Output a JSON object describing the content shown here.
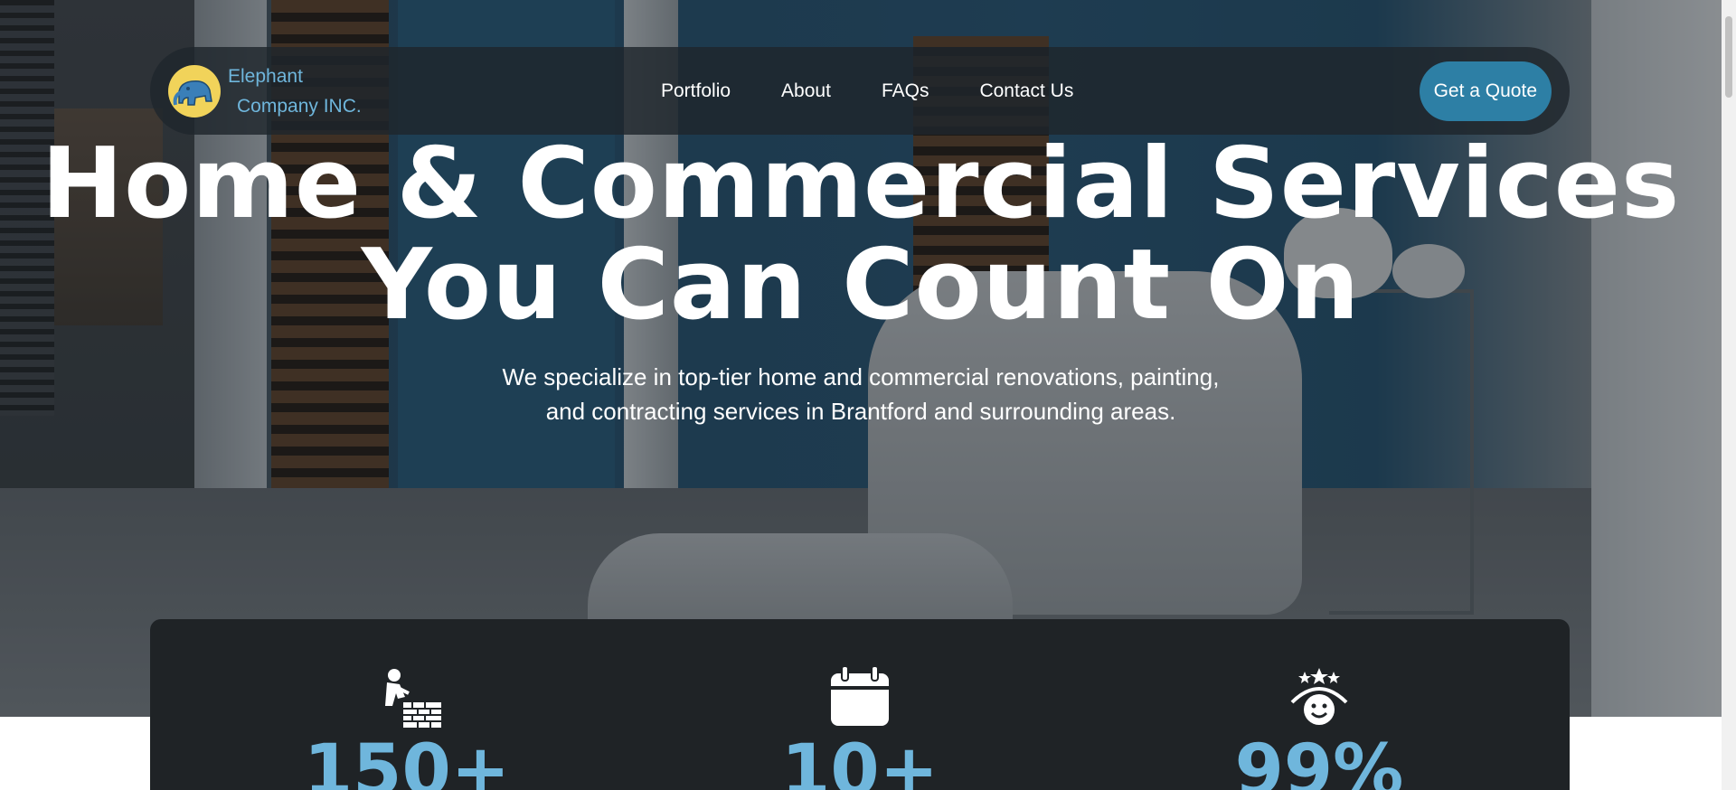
{
  "brand": {
    "line1": "Elephant",
    "line2": "Company INC.",
    "logo_icon": "elephant-logo"
  },
  "nav": {
    "items": [
      {
        "label": "Portfolio"
      },
      {
        "label": "About"
      },
      {
        "label": "FAQs"
      },
      {
        "label": "Contact Us"
      }
    ],
    "cta_label": "Get a Quote"
  },
  "hero": {
    "headline_line1": "Home & Commercial Services",
    "headline_line2": "You Can Count On",
    "sub_line1": "We specialize in top-tier home and commercial renovations, painting,",
    "sub_line2": "and contracting services in Brantford and surrounding areas."
  },
  "stats": [
    {
      "icon": "worker-bricks-icon",
      "value": "150+"
    },
    {
      "icon": "calendar-icon",
      "value": "10+"
    },
    {
      "icon": "happy-face-stars-icon",
      "value": "99%"
    }
  ],
  "colors": {
    "accent": "#6fb6dc",
    "button": "#2d7fa5",
    "panel": "#1f2326"
  }
}
